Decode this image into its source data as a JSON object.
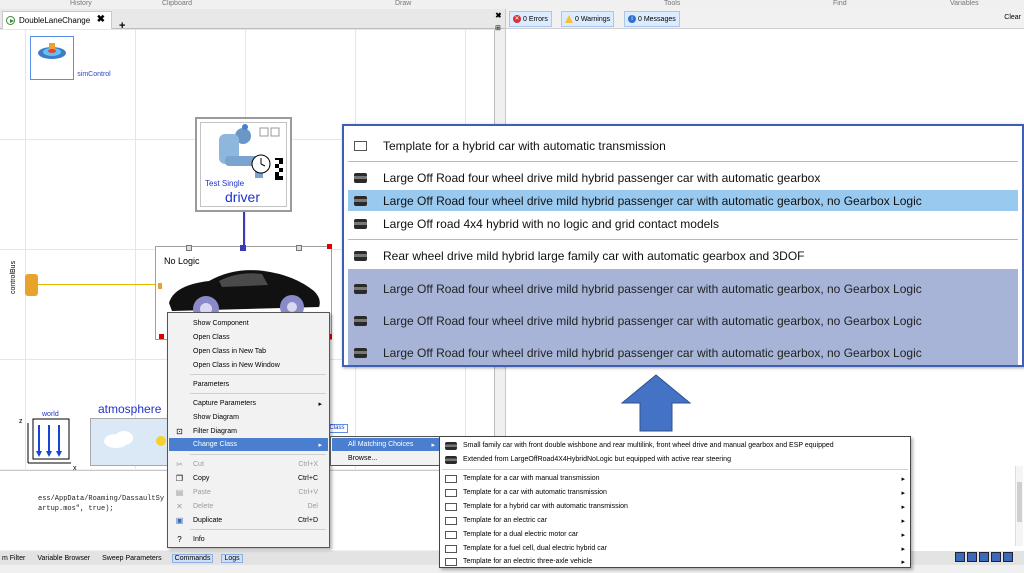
{
  "ribbon": {
    "groups": [
      "History",
      "Clipboard",
      "Draw",
      "Tools",
      "Find",
      "Variables"
    ]
  },
  "document": {
    "tab_title": "DoubleLaneChange",
    "tab_close": "✖",
    "add_tab": "+"
  },
  "diagram": {
    "simcontrol_label": "simControl",
    "driver_test_label": "Test Single",
    "driver_name": "driver",
    "car_label": "No Logic",
    "bus_label": "controlBus",
    "world_label": "world",
    "world_axis_z": "z",
    "world_axis_x": "x",
    "atmosphere_label": "atmosphere",
    "class_tag": "Class"
  },
  "console": {
    "line1": "ess/AppData/Roaming/DassaultSy",
    "line2": "artup.mos\", true);"
  },
  "messages": {
    "errors": "0 Errors",
    "warnings": "0 Warnings",
    "messages": "0 Messages",
    "clear": "Clear"
  },
  "bottom_tabs": [
    "m Filter",
    "Variable Browser",
    "Sweep Parameters",
    "Commands",
    "Logs"
  ],
  "context_menu": {
    "items": [
      {
        "label": "Show Component",
        "enabled": true
      },
      {
        "label": "Open Class",
        "enabled": true
      },
      {
        "label": "Open Class in New Tab",
        "enabled": true
      },
      {
        "label": "Open Class in New Window",
        "enabled": true
      },
      {
        "label": "Parameters",
        "enabled": true
      },
      {
        "label": "Capture Parameters",
        "enabled": true,
        "submenu": true
      },
      {
        "label": "Show Diagram",
        "enabled": true
      },
      {
        "label": "Filter Diagram",
        "enabled": true
      },
      {
        "label": "Change Class",
        "enabled": true,
        "submenu": true,
        "highlighted": true
      },
      {
        "label": "Cut",
        "shortcut": "Ctrl+X",
        "enabled": false
      },
      {
        "label": "Copy",
        "shortcut": "Ctrl+C",
        "enabled": true
      },
      {
        "label": "Paste",
        "shortcut": "Ctrl+V",
        "enabled": false
      },
      {
        "label": "Delete",
        "shortcut": "Del",
        "enabled": false
      },
      {
        "label": "Duplicate",
        "shortcut": "Ctrl+D",
        "enabled": true
      },
      {
        "label": "Info",
        "enabled": true
      }
    ]
  },
  "change_class_submenu": {
    "items": [
      {
        "label": "All Matching Choices",
        "highlighted": true
      },
      {
        "label": "Browse..."
      }
    ]
  },
  "matching_choices": {
    "items": [
      {
        "label": "Small family car with front double wishbone and rear multilink, front wheel drive and manual gearbox and ESP equipped",
        "icon": "car-icon"
      },
      {
        "label": "Extended from LargeOffRoad4X4HybridNoLogic but equipped with active rear steering",
        "icon": "car-icon"
      },
      {
        "label": "Template for a car with manual transmission",
        "icon": "class-icon",
        "submenu": true
      },
      {
        "label": "Template for a car with automatic transmission",
        "icon": "class-icon",
        "submenu": true
      },
      {
        "label": "Template for a hybrid car with automatic transmission",
        "icon": "class-icon",
        "submenu": true
      },
      {
        "label": "Template for an electric car",
        "icon": "class-icon",
        "submenu": true
      },
      {
        "label": "Template for a dual electric motor car",
        "icon": "class-icon",
        "submenu": true
      },
      {
        "label": "Template for a fuel cell, dual electric hybrid car",
        "icon": "class-icon",
        "submenu": true
      },
      {
        "label": "Template for an electric three-axle vehicle",
        "icon": "class-icon",
        "submenu": true
      }
    ]
  },
  "zoom_panel": {
    "rows": [
      {
        "label": "Template for a hybrid car with automatic transmission",
        "icon": "class-icon"
      },
      {
        "label": "Large Off Road four wheel drive mild hybrid passenger car with automatic gearbox",
        "icon": "car-icon"
      },
      {
        "label": "Large Off Road four wheel drive mild hybrid passenger car with automatic gearbox, no Gearbox Logic",
        "icon": "car-icon",
        "selected": true
      },
      {
        "label": "Large Off road 4x4 hybrid with no logic and grid contact models",
        "icon": "car-icon"
      },
      {
        "label": "Rear wheel drive mild hybrid large family car with automatic gearbox and 3DOF",
        "icon": "car-icon"
      },
      {
        "label": "Large Off Road four wheel drive mild hybrid passenger car with automatic gearbox, no Gearbox Logic",
        "icon": "car-icon"
      },
      {
        "label": "Large Off Road four wheel drive mild hybrid passenger car with automatic gearbox, no Gearbox Logic",
        "icon": "car-icon"
      },
      {
        "label": "Large Off Road four wheel drive mild hybrid passenger car with automatic gearbox, no Gearbox Logic",
        "icon": "car-icon"
      }
    ]
  },
  "colors": {
    "accent": "#4a7fd0",
    "selection": "#99c9ef",
    "callout_border": "#3e5fb2",
    "arrow": "#4472c4"
  }
}
